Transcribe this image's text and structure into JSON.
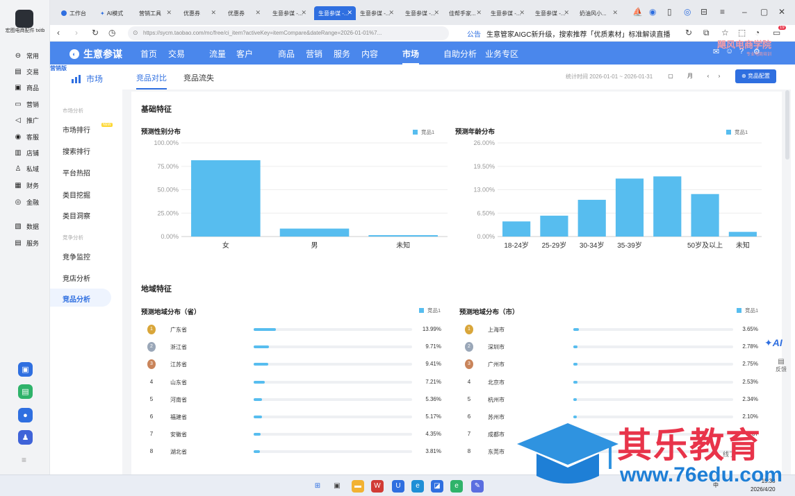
{
  "rail": {
    "company": "宏图电商配件 txitb",
    "items": [
      "常用",
      "交易",
      "商品",
      "营销",
      "推广",
      "客服",
      "店铺",
      "私域",
      "财务",
      "金融",
      "数据",
      "服务"
    ]
  },
  "browser": {
    "tabs": [
      "工作台",
      "AI模式",
      "营销工具",
      "优惠券",
      "优惠券",
      "生意参谋 -...",
      "生意参谋 -...",
      "生意参谋 -...",
      "生意参谋 -...",
      "佳帮手家...",
      "生意参谋 -...",
      "生意参谋 -...",
      "奶油风小..."
    ],
    "url": "https://sycm.taobao.com/mc/free/ci_item?activeKey=itemCompare&dateRange=2026-01-01%7...",
    "notice_tag": "公告",
    "notice_text": "生意管家AIGC新升级，搜索推荐「优质素材」标准解读直播",
    "badge_count": "19"
  },
  "topnav": {
    "brand": "生意参谋",
    "items": [
      "首页",
      "交易",
      "流量",
      "客户",
      "商品",
      "营销",
      "服务",
      "内容",
      "市场",
      "自助分析",
      "业务专区"
    ],
    "active": "市场"
  },
  "sidebar": {
    "edition": "营销版",
    "module": "市场",
    "group1": "市场分析",
    "items1": [
      "市场排行",
      "搜索排行",
      "平台热招",
      "类目挖掘",
      "类目洞察"
    ],
    "new_tag": "NEW",
    "group2": "竞争分析",
    "items2": [
      "竞争监控",
      "竞店分析",
      "竞品分析"
    ]
  },
  "subbar": {
    "tabs": [
      "竞品对比",
      "竞品流失"
    ],
    "stat": "统计时间 2026-01-01 ~ 2026-01-31",
    "day": "日",
    "month": "月",
    "config": "竞品配置"
  },
  "basic": {
    "title": "基础特征",
    "gender_title": "预测性别分布",
    "age_title": "预测年龄分布"
  },
  "legend_label": "竞品1",
  "region": {
    "title": "地域特征",
    "prov_title": "预测地域分布（省）",
    "city_title": "预测地域分布（市）",
    "provinces": [
      {
        "rank": "1",
        "name": "广东省",
        "pct": "13.99%",
        "v": 13.99
      },
      {
        "rank": "2",
        "name": "浙江省",
        "pct": "9.71%",
        "v": 9.71
      },
      {
        "rank": "3",
        "name": "江苏省",
        "pct": "9.41%",
        "v": 9.41
      },
      {
        "rank": "4",
        "name": "山东省",
        "pct": "7.21%",
        "v": 7.21
      },
      {
        "rank": "5",
        "name": "河南省",
        "pct": "5.36%",
        "v": 5.36
      },
      {
        "rank": "6",
        "name": "福建省",
        "pct": "5.17%",
        "v": 5.17
      },
      {
        "rank": "7",
        "name": "安徽省",
        "pct": "4.35%",
        "v": 4.35
      },
      {
        "rank": "8",
        "name": "湖北省",
        "pct": "3.81%",
        "v": 3.81
      }
    ],
    "cities": [
      {
        "rank": "1",
        "name": "上海市",
        "pct": "3.65%",
        "v": 3.65
      },
      {
        "rank": "2",
        "name": "深圳市",
        "pct": "2.78%",
        "v": 2.78
      },
      {
        "rank": "3",
        "name": "广州市",
        "pct": "2.75%",
        "v": 2.75
      },
      {
        "rank": "4",
        "name": "北京市",
        "pct": "2.53%",
        "v": 2.53
      },
      {
        "rank": "5",
        "name": "杭州市",
        "pct": "2.34%",
        "v": 2.34
      },
      {
        "rank": "6",
        "name": "苏州市",
        "pct": "2.10%",
        "v": 2.1
      },
      {
        "rank": "7",
        "name": "成都市",
        "pct": "1.87",
        "v": 1.87
      },
      {
        "rank": "8",
        "name": "东莞市",
        "pct": "",
        "v": 1.8
      }
    ]
  },
  "chart_data": [
    {
      "type": "bar",
      "title": "预测性别分布",
      "categories": [
        "女",
        "男",
        "未知"
      ],
      "series": [
        {
          "name": "竞品1",
          "values": [
            81.5,
            8.5,
            1.5
          ]
        }
      ],
      "yticks": [
        "0.00%",
        "25.00%",
        "50.00%",
        "75.00%",
        "100.00%"
      ],
      "ylim": [
        0,
        100
      ]
    },
    {
      "type": "bar",
      "title": "预测年龄分布",
      "categories": [
        "18-24岁",
        "25-29岁",
        "30-34岁",
        "35-39岁",
        "",
        "50岁及以上",
        "未知"
      ],
      "series": [
        {
          "name": "竞品1",
          "values": [
            4.2,
            5.8,
            10.2,
            16.1,
            16.7,
            11.8,
            1.3
          ]
        }
      ],
      "yticks": [
        "0.00%",
        "6.50%",
        "13.00%",
        "19.50%",
        "26.00%"
      ],
      "ylim": [
        0,
        26
      ]
    }
  ],
  "float": {
    "ai": "AI",
    "feedback": "反馈"
  },
  "taskbar": {
    "lang": "中",
    "time": "15:38",
    "date": "2026/4/20"
  },
  "watermark": {
    "text": "其乐教育",
    "url": "www.76edu.com",
    "corner": "飓风电商学院",
    "corner_sub": "专业电商培训"
  },
  "remnant": "线了"
}
